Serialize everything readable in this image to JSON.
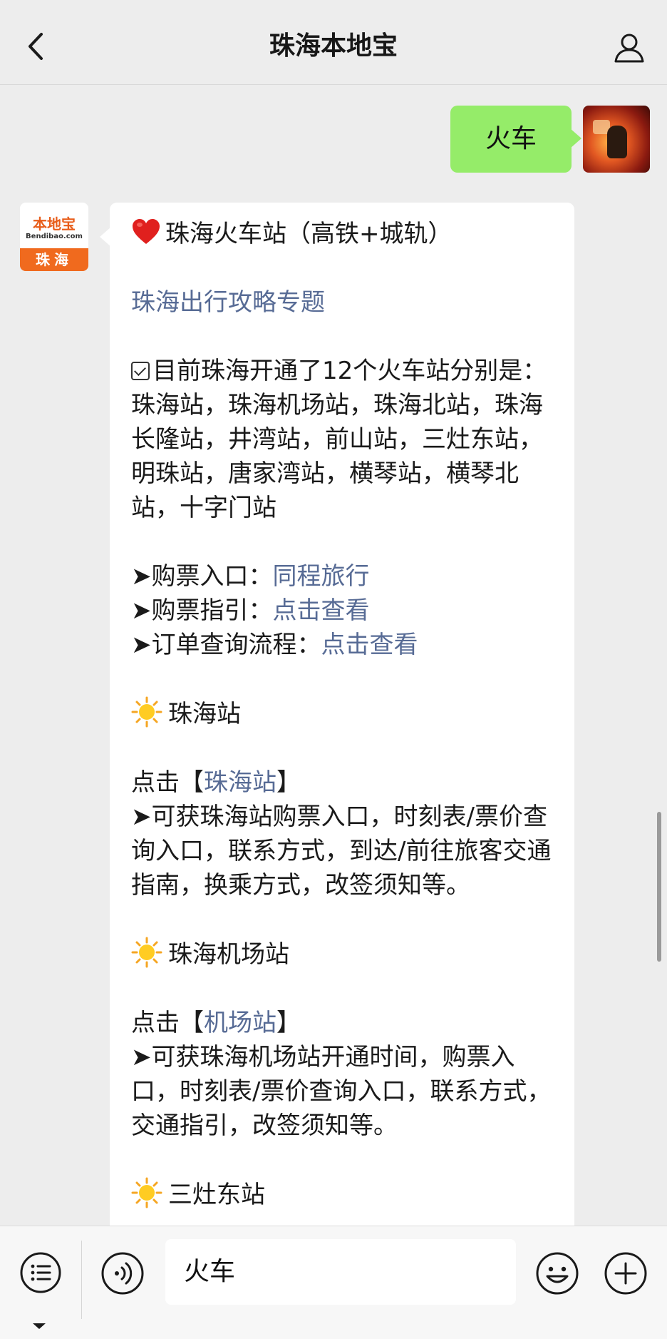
{
  "header": {
    "title": "珠海本地宝"
  },
  "user_message": {
    "text": "火车"
  },
  "bot": {
    "avatar_logo": "本地宝",
    "avatar_sub": "Bendibao.com",
    "avatar_city": "珠海"
  },
  "reply": {
    "headline": "珠海火车站（高铁+城轨）",
    "topic_link": "珠海出行攻略专题",
    "intro": "目前珠海开通了12个火车站分别是：珠海站，珠海机场站，珠海北站，珠海长隆站，井湾站，前山站，三灶东站，明珠站，唐家湾站，横琴站，横琴北站，十字门站",
    "ticket_entry_label": "➤购票入口：",
    "ticket_entry_link": "同程旅行",
    "ticket_guide_label": "➤购票指引：",
    "ticket_guide_link": "点击查看",
    "order_query_label": "➤订单查询流程：",
    "order_query_link": "点击查看",
    "section1_title": "珠海站",
    "section1_click_prefix": "点击【",
    "section1_click_link": "珠海站",
    "section1_click_suffix": "】",
    "section1_desc": "➤可获珠海站购票入口，时刻表/票价查询入口，联系方式，到达/前往旅客交通指南，换乘方式，改签须知等。",
    "section2_title": "珠海机场站",
    "section2_click_prefix": "点击【",
    "section2_click_link": "机场站",
    "section2_click_suffix": "】",
    "section2_desc": "➤可获珠海机场站开通时间，购票入口，时刻表/票价查询入口，联系方式，交通指引，改签须知等。",
    "section3_title_partial": "三灶东站"
  },
  "input": {
    "value": "火车"
  },
  "icons": {
    "back": "chevron-left-icon",
    "profile": "person-icon",
    "menu": "list-menu-icon",
    "voice": "voice-icon",
    "emoji": "smiley-icon",
    "plus": "plus-icon"
  },
  "colors": {
    "user_bubble": "#95ec69",
    "link": "#576b95",
    "brand_orange": "#f06a1e"
  }
}
